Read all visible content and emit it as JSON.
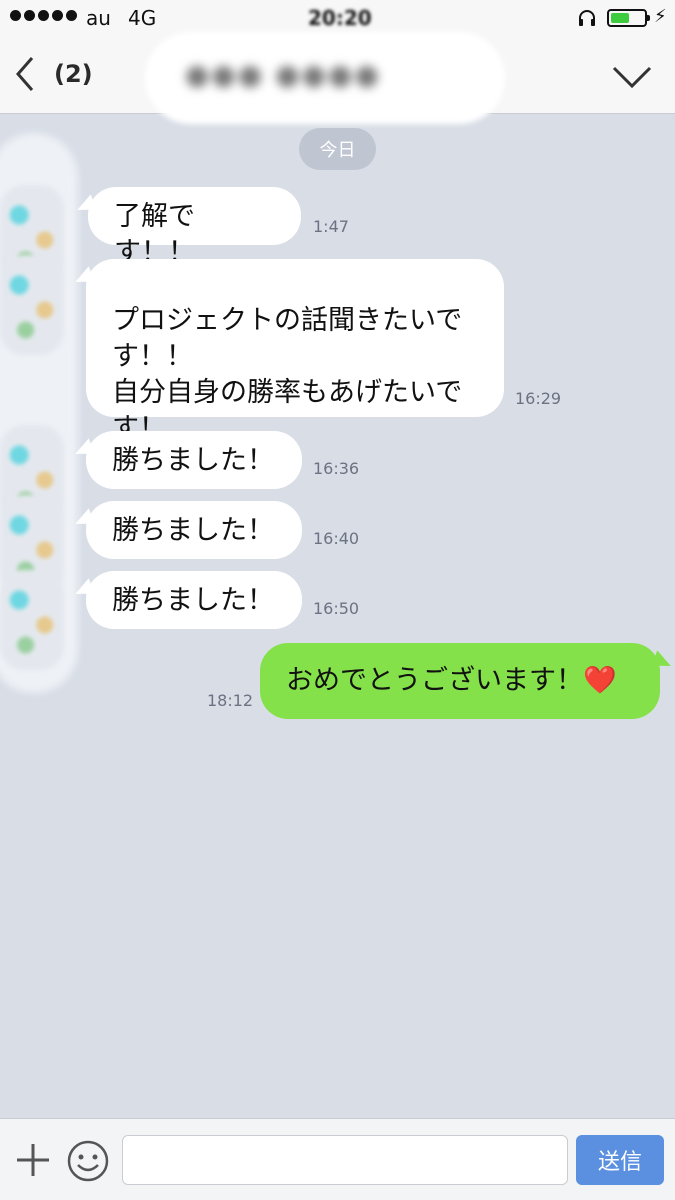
{
  "status_bar": {
    "carrier": "au",
    "network": "4G",
    "time": "20:20",
    "battery_level": 0.55,
    "charging_symbol": "⚡"
  },
  "header": {
    "unread_count": "(2)",
    "title": "●●● ●●●●"
  },
  "date_label": "今日",
  "messages": [
    {
      "side": "left",
      "text": "了解です！！",
      "time": "1:47"
    },
    {
      "side": "left",
      "text": "プロジェクトの話聞きたいで\nす！！\n自分自身の勝率もあげたいで\nす！",
      "time": "16:29"
    },
    {
      "side": "left",
      "text": "勝ちました！",
      "time": "16:36"
    },
    {
      "side": "left",
      "text": "勝ちました！",
      "time": "16:40"
    },
    {
      "side": "left",
      "text": "勝ちました！",
      "time": "16:50"
    },
    {
      "side": "right",
      "text": "おめでとうございます！",
      "emoji": "❤️",
      "time": "18:12"
    }
  ],
  "input": {
    "placeholder": "",
    "send_label": "送信"
  },
  "colors": {
    "chat_background": "#d8dde6",
    "incoming_bubble": "#ffffff",
    "outgoing_bubble": "#84e149",
    "send_button": "#5b8fe0"
  }
}
